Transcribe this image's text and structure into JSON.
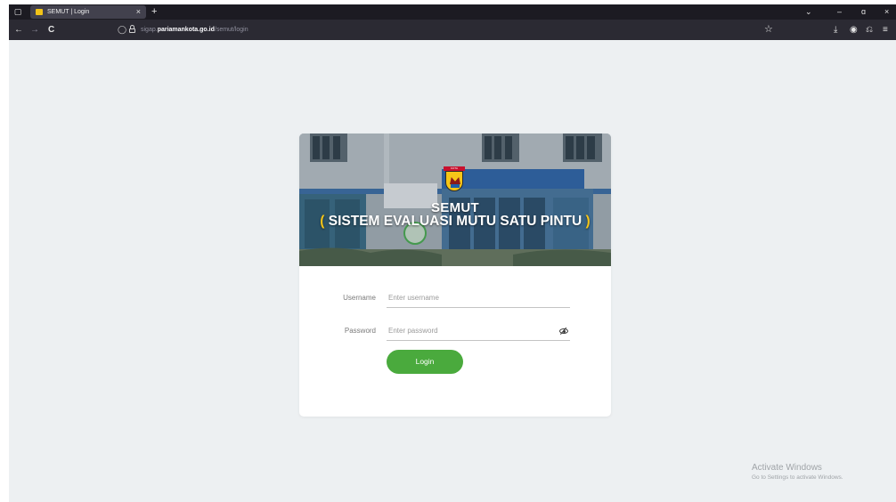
{
  "browser": {
    "tab": {
      "title": "SEMUT | Login",
      "close_glyph": "×"
    },
    "new_tab_glyph": "+",
    "window_controls": {
      "menu": "⌄",
      "minimize": "–",
      "restore": "ɑ",
      "close": "×"
    },
    "nav": {
      "back": "←",
      "forward": "→",
      "reload": "C"
    },
    "address": {
      "prefix": "sigap.",
      "domain": "pariamankota.go.id",
      "path": "/semut/login"
    },
    "toolbar_glyphs": {
      "bookmark": "☆",
      "download": "⤓",
      "account": "◉",
      "extensions": "⎌",
      "menu": "≡"
    }
  },
  "banner": {
    "crest_label": "KOTA PARIAMAN",
    "title": "SEMUT",
    "subtitle": "SISTEM EVALUASI MUTU SATU PINTU",
    "paren_open": "(",
    "paren_close": ")"
  },
  "form": {
    "username_label": "Username",
    "username_placeholder": "Enter username",
    "password_label": "Password",
    "password_placeholder": "Enter password",
    "login_label": "Login"
  },
  "watermark": {
    "line1": "Activate Windows",
    "line2": "Go to Settings to activate Windows."
  },
  "colors": {
    "accent": "#4aaa3d",
    "chrome_dark": "#1c1b22",
    "page_bg": "#edf0f2"
  }
}
